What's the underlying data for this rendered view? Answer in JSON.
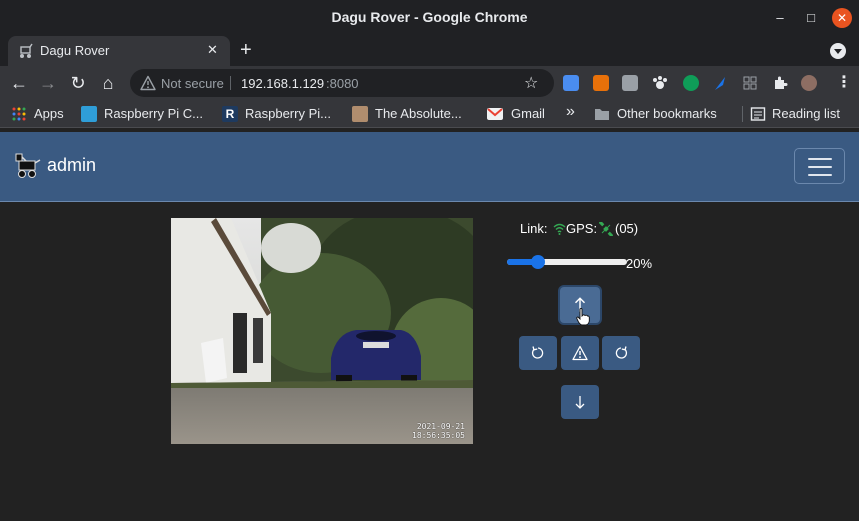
{
  "window": {
    "title": "Dagu Rover - Google Chrome",
    "minimize_glyph": "–",
    "maximize_glyph": "□",
    "close_glyph": "✕"
  },
  "tab": {
    "title": "Dagu Rover",
    "close_glyph": "✕",
    "new_tab_glyph": "+"
  },
  "toolbar": {
    "back_glyph": "←",
    "forward_glyph": "→",
    "reload_glyph": "↻",
    "home_glyph": "⌂",
    "security_label": "Not secure",
    "url_host": "192.168.1.129",
    "url_port": ":8080",
    "bookmark_star_glyph": "☆",
    "menu_glyph": "⋮",
    "extension_icons": [
      "ext-blue-icon",
      "ext-orange-icon",
      "ext-grey-icon",
      "ext-paw-icon",
      "ext-green-icon",
      "ext-feather-icon",
      "ext-grid-icon",
      "puzzle-icon",
      "profile-avatar"
    ]
  },
  "bookmarks": {
    "apps": "Apps",
    "items": [
      "Raspberry Pi C...",
      "Raspberry Pi...",
      "The Absolute...",
      "Gmail"
    ],
    "overflow_glyph": "»",
    "other_bookmarks": "Other bookmarks",
    "reading_list": "Reading list"
  },
  "app": {
    "brand": "admin",
    "link_label": "Link:",
    "gps_label": "GPS:",
    "satellite_count": "(05)",
    "speed_percent": 20,
    "speed_label": "20%",
    "video_stamp_date": "2021-09-21",
    "video_stamp_time": "18:56:35:05",
    "colors": {
      "navbar": "#3a5a82",
      "button": "#3a5a82",
      "slider_accent": "#1a73e8",
      "status_green": "#34a853",
      "page_background": "#222222"
    }
  }
}
